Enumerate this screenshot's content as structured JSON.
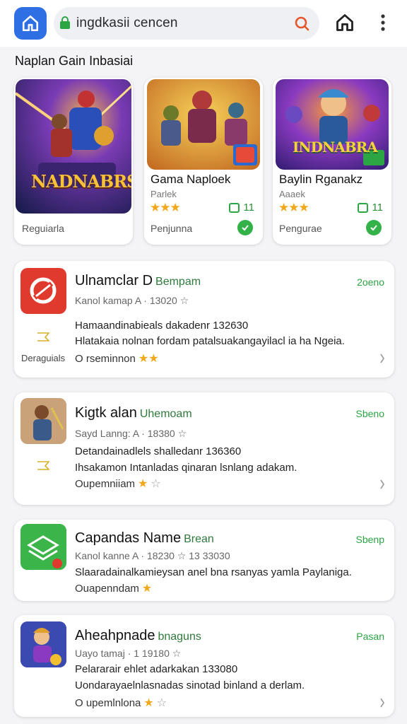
{
  "header": {
    "url": "ingdkasii cencen",
    "colors": {
      "accent": "#2f6fe4",
      "lock": "#2ca544",
      "search": "#e4572e"
    },
    "icons": [
      "home-icon",
      "lock-icon",
      "search-icon",
      "home-outline-icon",
      "more-vertical-icon"
    ]
  },
  "section": {
    "title": "Naplan Gain Inbasiai"
  },
  "games": [
    {
      "art_text": "NADNABRS",
      "name": "",
      "sub": "",
      "stars": "",
      "count": "",
      "footer": "Reguiarla"
    },
    {
      "art_text": "",
      "name": "Gama Naploek",
      "sub": "Parlek",
      "stars": "★★★",
      "count": "11",
      "footer": "Penjunna"
    },
    {
      "art_text": "INDNABRA",
      "name": "Baylin Rganakz",
      "sub": "Aaaek",
      "stars": "★★★",
      "count": "11",
      "footer": "Pengurae"
    }
  ],
  "apps": [
    {
      "title": "Ulnamclar D",
      "title_sub": "Bempam",
      "meta": "Kanol kamap A · 13020 ☆",
      "desc1": "Hamaandinabieals dakadenr 132630",
      "desc2": "Hlatakaia nolnan fordam patalsuakangayilacl ia ha Ngeia.",
      "footer": "O rseminnon",
      "stars": "★★",
      "empty_stars": "",
      "side": "Deraguials",
      "right": "2oeno"
    },
    {
      "title": "Kigtk alan",
      "title_sub": "Uhemoam",
      "meta": "Sayd Lanng: A · 18380 ☆",
      "desc1": "Detandainadlels shalledanr 136360",
      "desc2": "Ihsakamon Intanladas qinaran lsnlang adakam.",
      "footer": "Oupemniiam",
      "stars": "★",
      "empty_stars": "☆",
      "side": "",
      "right": "Sbeno"
    },
    {
      "title": "Capandas Name",
      "title_sub": "Brean",
      "meta": "Kanol kanne A · 18230 ☆   13 33030",
      "desc1": "",
      "desc2": "Slaaradainalkamieysan anel bna rsanyas yamla Paylaniga.",
      "footer": "Ouapenndam",
      "stars": "★",
      "empty_stars": "",
      "side": "",
      "right": "Sbenp"
    },
    {
      "title": "Aheahpnade",
      "title_sub": "bnaguns",
      "meta": "Uayo tamaj · 1 19180 ☆",
      "desc1": "Pelararair ehlet adarkakan 133080",
      "desc2": "Uondarayaelnlasnadas sinotad binland a derlam.",
      "footer": "O upemlnlona",
      "stars": "★",
      "empty_stars": "☆",
      "side": "",
      "right": "Pasan"
    }
  ]
}
